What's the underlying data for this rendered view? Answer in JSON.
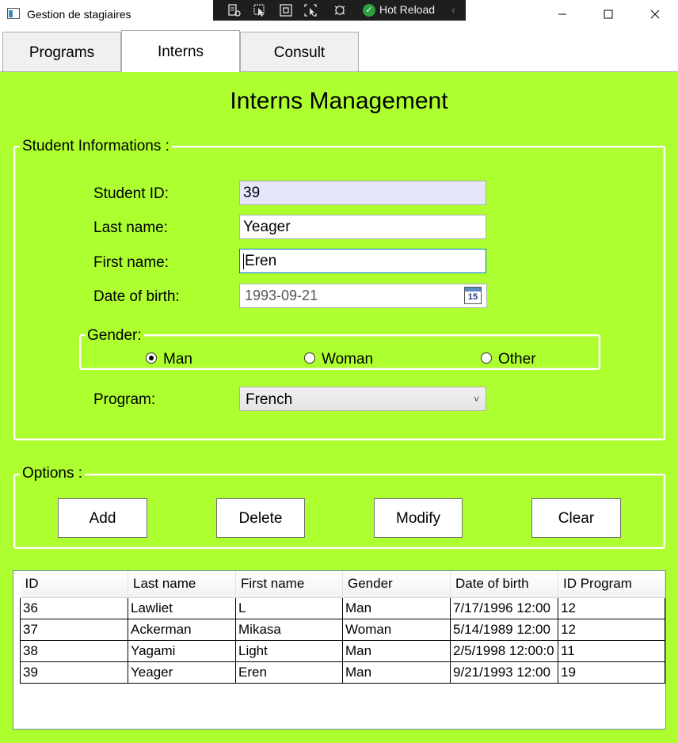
{
  "window": {
    "title": "Gestion de stagiaires",
    "hot_reload_label": "Hot Reload",
    "controls": [
      "minimize",
      "maximize",
      "close"
    ]
  },
  "tabs": [
    {
      "label": "Programs",
      "active": false
    },
    {
      "label": "Interns",
      "active": true
    },
    {
      "label": "Consult",
      "active": false
    }
  ],
  "main": {
    "heading": "Interns Management",
    "accent_color": "#adff2f"
  },
  "student_info": {
    "group_label": "Student Informations :",
    "student_id_label": "Student ID:",
    "student_id_value": "39",
    "last_name_label": "Last name:",
    "last_name_value": "Yeager",
    "first_name_label": "First name:",
    "first_name_value": "Eren",
    "dob_label": "Date of birth:",
    "dob_value": "1993-09-21",
    "calendar_day": "15",
    "gender": {
      "group_label": "Gender:",
      "options": [
        {
          "label": "Man",
          "checked": true
        },
        {
          "label": "Woman",
          "checked": false
        },
        {
          "label": "Other",
          "checked": false
        }
      ]
    },
    "program_label": "Program:",
    "program_value": "French"
  },
  "options": {
    "group_label": "Options :",
    "add_label": "Add",
    "delete_label": "Delete",
    "modify_label": "Modify",
    "clear_label": "Clear"
  },
  "grid": {
    "columns": [
      "ID",
      "Last name",
      "First name",
      "Gender",
      "Date of birth",
      "ID Program"
    ],
    "rows": [
      [
        "36",
        "Lawliet",
        "L",
        "Man",
        "7/17/1996 12:00",
        "12"
      ],
      [
        "37",
        "Ackerman",
        "Mikasa",
        "Woman",
        "5/14/1989 12:00",
        "12"
      ],
      [
        "38",
        "Yagami",
        "Light",
        "Man",
        "2/5/1998 12:00:0",
        "11"
      ],
      [
        "39",
        "Yeager",
        "Eren",
        "Man",
        "9/21/1993 12:00",
        "19"
      ]
    ]
  }
}
